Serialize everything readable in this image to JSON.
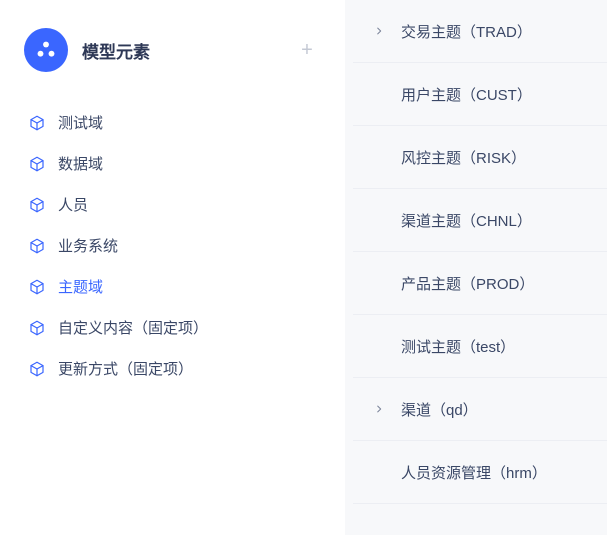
{
  "left": {
    "title": "模型元素",
    "nav": [
      {
        "label": "测试域",
        "active": false
      },
      {
        "label": "数据域",
        "active": false
      },
      {
        "label": "人员",
        "active": false
      },
      {
        "label": "业务系统",
        "active": false
      },
      {
        "label": "主题域",
        "active": true
      },
      {
        "label": "自定义内容（固定项）",
        "active": false
      },
      {
        "label": "更新方式（固定项）",
        "active": false
      }
    ],
    "plus_label": "+"
  },
  "right": {
    "items": [
      {
        "label": "交易主题（TRAD）",
        "has_children": true
      },
      {
        "label": "用户主题（CUST）",
        "has_children": false
      },
      {
        "label": "风控主题（RISK）",
        "has_children": false
      },
      {
        "label": "渠道主题（CHNL）",
        "has_children": false
      },
      {
        "label": "产品主题（PROD）",
        "has_children": false
      },
      {
        "label": "测试主题（test）",
        "has_children": false
      },
      {
        "label": "渠道（qd）",
        "has_children": true
      },
      {
        "label": "人员资源管理（hrm）",
        "has_children": false
      }
    ]
  },
  "icons": {
    "modules": "modules-icon",
    "cube": "cube-icon",
    "plus": "plus-icon",
    "chevron_right": "chevron-right-icon"
  },
  "colors": {
    "accent": "#3a66ff",
    "text": "#3a4766",
    "muted": "#c4c9d4",
    "divider": "#eceef3",
    "bg": "#f7f8fa"
  }
}
